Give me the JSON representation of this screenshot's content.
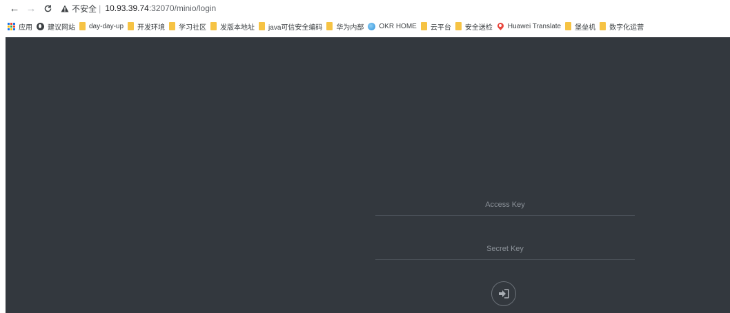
{
  "address_bar": {
    "insecure_label": "不安全",
    "separator": "|",
    "url_host": "10.93.39.74",
    "url_path": ":32070/minio/login"
  },
  "bookmarks": [
    {
      "label": "应用",
      "icon": "apps-grid-icon"
    },
    {
      "label": "建议网站",
      "icon": "globe-icon"
    },
    {
      "label": "day-day-up",
      "icon": "folder-icon"
    },
    {
      "label": "开发环境",
      "icon": "folder-icon"
    },
    {
      "label": "学习社区",
      "icon": "folder-icon"
    },
    {
      "label": "发版本地址",
      "icon": "folder-icon"
    },
    {
      "label": "java可信安全编码",
      "icon": "folder-icon"
    },
    {
      "label": "华为内部",
      "icon": "folder-icon"
    },
    {
      "label": "OKR HOME",
      "icon": "okr-globe-icon"
    },
    {
      "label": "云平台",
      "icon": "folder-icon"
    },
    {
      "label": "安全送检",
      "icon": "folder-icon"
    },
    {
      "label": "Huawei Translate",
      "icon": "huawei-pin-icon"
    },
    {
      "label": "堡垒机",
      "icon": "folder-icon"
    },
    {
      "label": "数字化运营",
      "icon": "folder-icon"
    }
  ],
  "login": {
    "access_key_placeholder": "Access Key",
    "secret_key_placeholder": "Secret Key",
    "access_key_value": "",
    "secret_key_value": "",
    "submit_icon": "sign-in-arrow-icon"
  },
  "colors": {
    "page_background": "#33383e",
    "field_underline": "#4a5058",
    "placeholder": "#8a9097",
    "bookmark_folder": "#f6c344"
  }
}
